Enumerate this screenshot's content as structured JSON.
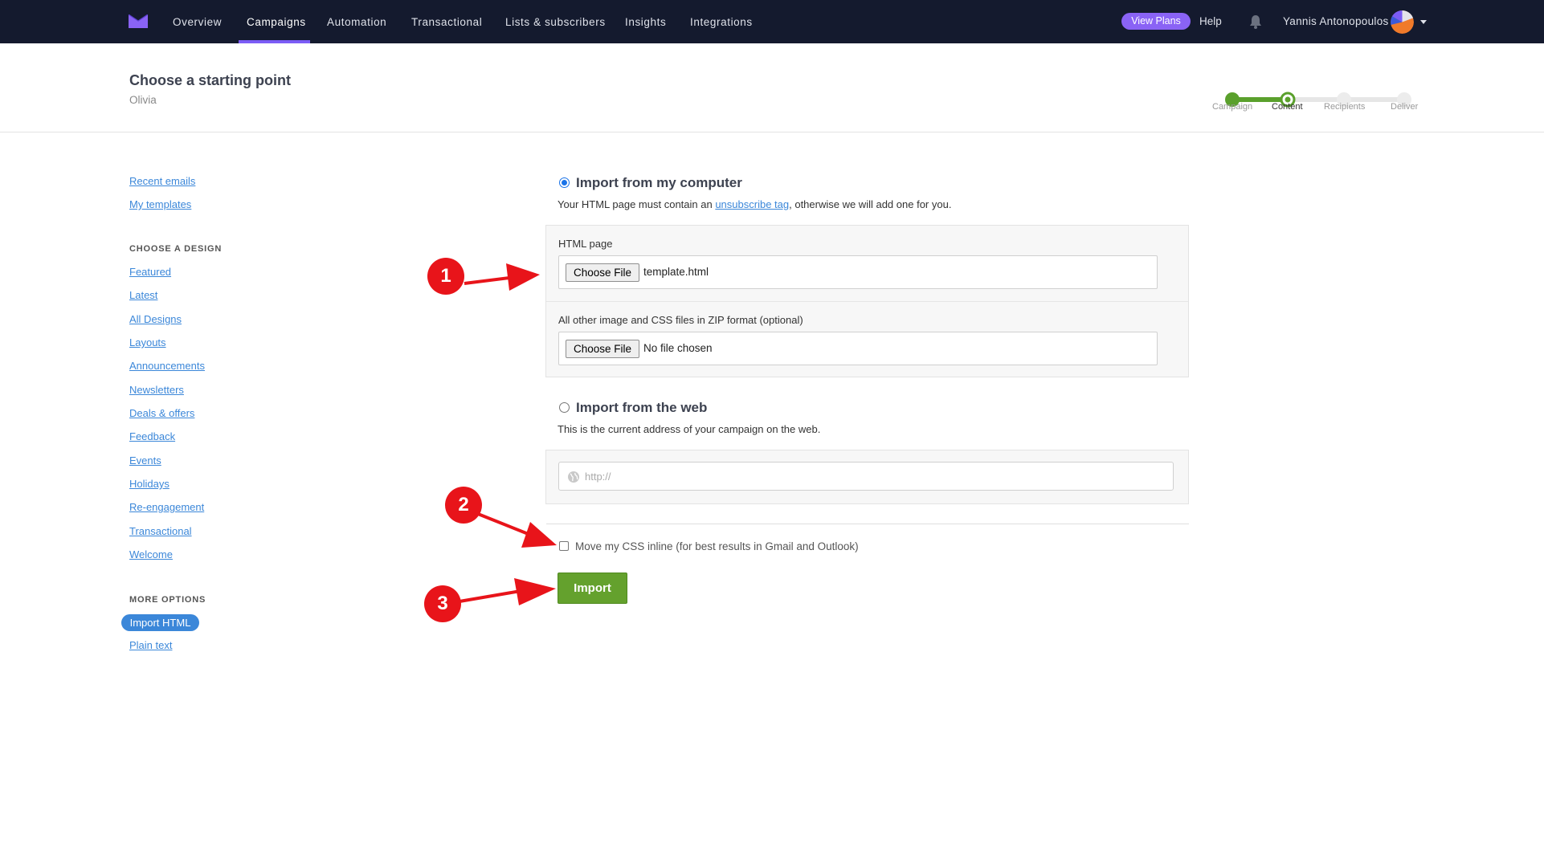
{
  "nav": {
    "items": [
      {
        "label": "Overview"
      },
      {
        "label": "Campaigns"
      },
      {
        "label": "Automation"
      },
      {
        "label": "Transactional"
      },
      {
        "label": "Lists & subscribers"
      },
      {
        "label": "Insights"
      },
      {
        "label": "Integrations"
      }
    ],
    "active": "Campaigns",
    "view_plans": "View Plans",
    "help": "Help",
    "username": "Yannis Antonopoulos",
    "colors": {
      "bar": "#141a2e",
      "accent": "#7b5cf6",
      "pill": "#8a63f5"
    }
  },
  "header": {
    "title": "Choose a starting point",
    "subtitle": "Olivia",
    "steps": [
      {
        "label": "Campaign",
        "state": "done"
      },
      {
        "label": "Content",
        "state": "current"
      },
      {
        "label": "Recipients",
        "state": "todo"
      },
      {
        "label": "Deliver",
        "state": "todo"
      }
    ]
  },
  "sidebar": {
    "top_links": [
      {
        "label": "Recent emails"
      },
      {
        "label": "My templates"
      }
    ],
    "design_heading": "CHOOSE A DESIGN",
    "design_links": [
      {
        "label": "Featured"
      },
      {
        "label": "Latest"
      },
      {
        "label": "All Designs"
      },
      {
        "label": "Layouts"
      },
      {
        "label": "Announcements"
      },
      {
        "label": "Newsletters"
      },
      {
        "label": "Deals & offers"
      },
      {
        "label": "Feedback"
      },
      {
        "label": "Events"
      },
      {
        "label": "Holidays"
      },
      {
        "label": "Re-engagement"
      },
      {
        "label": "Transactional"
      },
      {
        "label": "Welcome"
      }
    ],
    "more_heading": "MORE OPTIONS",
    "more_links": [
      {
        "label": "Import HTML",
        "active": true
      },
      {
        "label": "Plain text"
      }
    ]
  },
  "import_computer": {
    "title": "Import from my computer",
    "selected": true,
    "help_before": "Your HTML page must contain an ",
    "help_link": "unsubscribe tag",
    "help_after": ", otherwise we will add one for you.",
    "html_label": "HTML page",
    "html_button": "Choose File",
    "html_file": "template.html",
    "zip_label": "All other image and CSS files in ZIP format (optional)",
    "zip_button": "Choose File",
    "zip_file": "No file chosen"
  },
  "import_web": {
    "title": "Import from the web",
    "selected": false,
    "help": "This is the current address of your campaign on the web.",
    "url_placeholder": "http://"
  },
  "options": {
    "inline_css_label": "Move my CSS inline (for best results in Gmail and Outlook)",
    "inline_css_checked": false,
    "import_button": "Import",
    "import_color": "#64a12d"
  },
  "annotations": [
    "1",
    "2",
    "3"
  ],
  "annotation_color": "#e8141a"
}
